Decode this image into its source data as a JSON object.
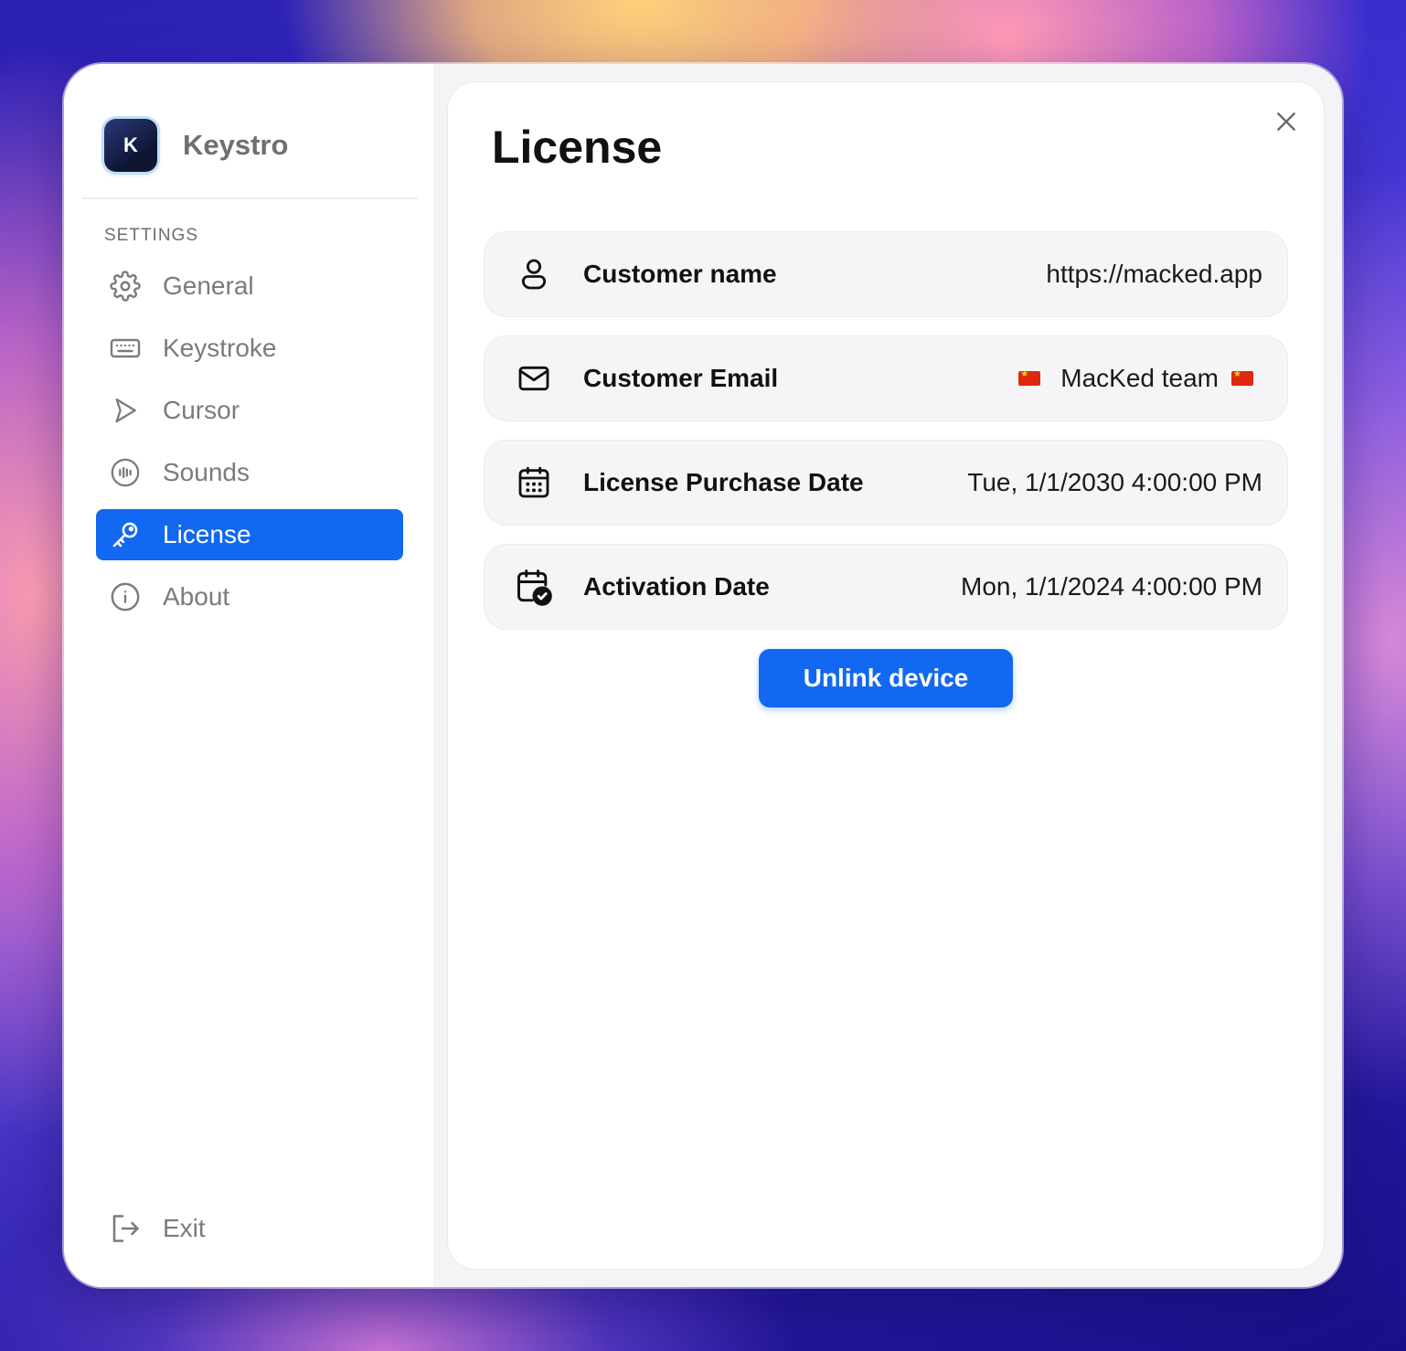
{
  "app": {
    "name": "Keystro",
    "icon_letter": "K"
  },
  "sidebar": {
    "section_label": "SETTINGS",
    "items": [
      {
        "label": "General",
        "icon": "gear-icon",
        "active": false
      },
      {
        "label": "Keystroke",
        "icon": "keyboard-icon",
        "active": false
      },
      {
        "label": "Cursor",
        "icon": "cursor-icon",
        "active": false
      },
      {
        "label": "Sounds",
        "icon": "sound-wave-icon",
        "active": false
      },
      {
        "label": "License",
        "icon": "key-icon",
        "active": true
      },
      {
        "label": "About",
        "icon": "info-icon",
        "active": false
      }
    ],
    "exit_label": "Exit"
  },
  "main": {
    "title": "License",
    "rows": [
      {
        "label": "Customer name",
        "value": "https://macked.app",
        "icon": "user-icon"
      },
      {
        "label": "Customer Email",
        "value": "MacKed team",
        "icon": "mail-icon"
      },
      {
        "label": "License Purchase Date",
        "value": "Tue, 1/1/2030 4:00:00 PM",
        "icon": "calendar-icon"
      },
      {
        "label": "Activation Date",
        "value": "Mon, 1/1/2024 4:00:00 PM",
        "icon": "calendar-check-icon"
      }
    ],
    "unlink_label": "Unlink device"
  },
  "colors": {
    "accent": "#1268f0",
    "sidebar_text": "#7a7a80",
    "row_background": "#f5f5f7"
  }
}
